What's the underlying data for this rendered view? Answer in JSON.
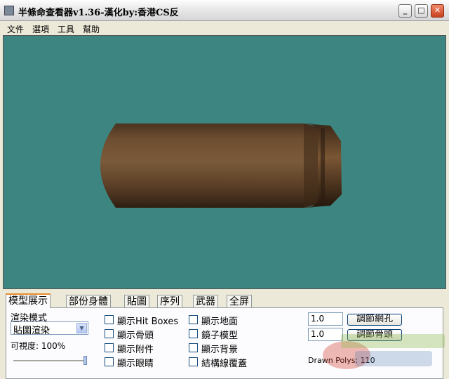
{
  "window": {
    "title": "半條命查看器v1.36-漢化by:香港CS反",
    "icon": "app-icon",
    "controls": {
      "minimize": "_",
      "maximize": "□",
      "close": "✕"
    }
  },
  "menu": {
    "items": [
      "文件",
      "選項",
      "工具",
      "幫助"
    ]
  },
  "tabs": [
    "模型展示",
    "部份身體",
    "貼圖",
    "序列",
    "武器",
    "全屏"
  ],
  "active_tab": "模型展示",
  "render": {
    "mode_label": "渲染模式",
    "mode_value": "貼圖渲染",
    "visibility_label": "可視度: 100%",
    "visibility": 1.0
  },
  "checkboxes": {
    "col1": [
      "顯示Hit Boxes",
      "顯示骨頭",
      "顯示附件",
      "顯示眼睛"
    ],
    "col2": [
      "顯示地面",
      "鏡子模型",
      "顯示背景",
      "結構線覆蓋"
    ]
  },
  "adjust": [
    {
      "value": "1.0",
      "button": "調節網孔"
    },
    {
      "value": "1.0",
      "button": "調節骨頭"
    }
  ],
  "drawn_polys": "Drawn Polys: 110",
  "colors": {
    "viewport_bg": "#3c8580",
    "model": "#6b4a2e",
    "tab_accent": "#e68b2c"
  }
}
